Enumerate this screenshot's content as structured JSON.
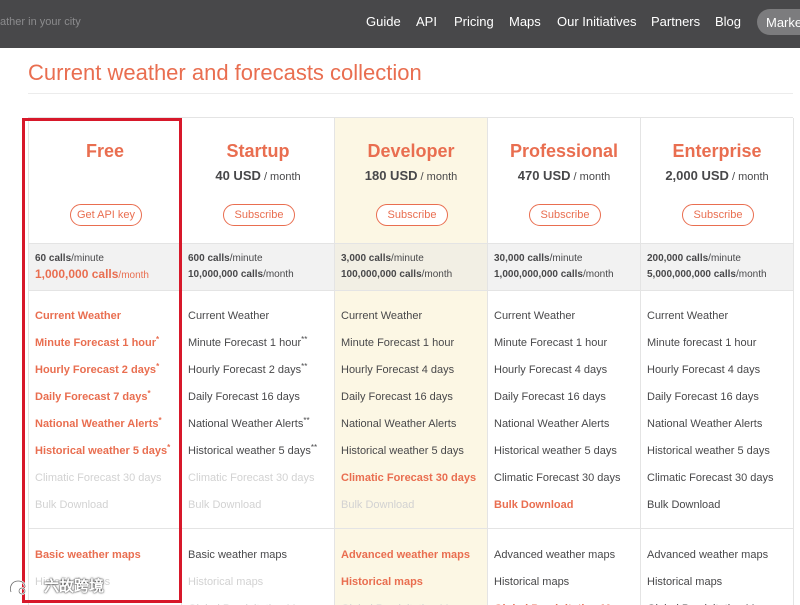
{
  "nav": {
    "search_placeholder": "ather in your city",
    "links": [
      "Guide",
      "API",
      "Pricing",
      "Maps",
      "Our Initiatives",
      "Partners",
      "Blog"
    ],
    "marketplace_label": "Marke"
  },
  "page_title": "Current weather and forecasts collection",
  "plans": [
    {
      "name": "Free",
      "price": "",
      "per": "",
      "button": "Get API key",
      "calls_minute": "60 calls",
      "calls_minute_unit": "/minute",
      "calls_month": "1,000,000 calls",
      "calls_month_unit": "/month",
      "features": [
        {
          "text": "Current Weather",
          "mark": "",
          "style": "orange"
        },
        {
          "text": "Minute Forecast 1 hour",
          "mark": "*",
          "style": "orange"
        },
        {
          "text": "Hourly Forecast 2 days",
          "mark": "*",
          "style": "orange"
        },
        {
          "text": "Daily Forecast 7 days",
          "mark": "*",
          "style": "orange"
        },
        {
          "text": "National Weather Alerts",
          "mark": "*",
          "style": "orange"
        },
        {
          "text": "Historical weather 5 days",
          "mark": "*",
          "style": "orange"
        },
        {
          "text": "Climatic Forecast 30 days",
          "mark": "",
          "style": "disabled"
        },
        {
          "text": "Bulk Download",
          "mark": "",
          "style": "disabled"
        }
      ],
      "maps": [
        {
          "text": "Basic weather maps",
          "style": "orange"
        },
        {
          "text": "Historical maps",
          "style": "disabled"
        }
      ]
    },
    {
      "name": "Startup",
      "price": "40 USD",
      "per": " / month",
      "button": "Subscribe",
      "calls_minute": "600 calls",
      "calls_minute_unit": "/minute",
      "calls_month": "10,000,000 calls",
      "calls_month_unit": "/month",
      "features": [
        {
          "text": "Current Weather",
          "mark": "",
          "style": "normal"
        },
        {
          "text": "Minute Forecast 1 hour",
          "mark": "**",
          "style": "normal"
        },
        {
          "text": "Hourly Forecast 2 days",
          "mark": "**",
          "style": "normal"
        },
        {
          "text": "Daily Forecast 16 days",
          "mark": "",
          "style": "normal"
        },
        {
          "text": "National Weather Alerts",
          "mark": "**",
          "style": "normal"
        },
        {
          "text": "Historical weather 5 days",
          "mark": "**",
          "style": "normal"
        },
        {
          "text": "Climatic Forecast 30 days",
          "mark": "",
          "style": "disabled"
        },
        {
          "text": "Bulk Download",
          "mark": "",
          "style": "disabled"
        }
      ],
      "maps": [
        {
          "text": "Basic weather maps",
          "style": "normal"
        },
        {
          "text": "Historical maps",
          "style": "disabled"
        },
        {
          "text": "Global Precipitation Map",
          "style": "disabled"
        }
      ]
    },
    {
      "name": "Developer",
      "price": "180 USD",
      "per": " / month",
      "button": "Subscribe",
      "calls_minute": "3,000 calls",
      "calls_minute_unit": "/minute",
      "calls_month": "100,000,000 calls",
      "calls_month_unit": "/month",
      "features": [
        {
          "text": "Current Weather",
          "mark": "",
          "style": "normal"
        },
        {
          "text": "Minute Forecast 1 hour",
          "mark": "",
          "style": "normal"
        },
        {
          "text": "Hourly Forecast 4 days",
          "mark": "",
          "style": "normal"
        },
        {
          "text": "Daily Forecast 16 days",
          "mark": "",
          "style": "normal"
        },
        {
          "text": "National Weather Alerts",
          "mark": "",
          "style": "normal"
        },
        {
          "text": "Historical weather 5 days",
          "mark": "",
          "style": "normal"
        },
        {
          "text": "Climatic Forecast 30 days",
          "mark": "",
          "style": "orange"
        },
        {
          "text": "Bulk Download",
          "mark": "",
          "style": "disabled"
        }
      ],
      "maps": [
        {
          "text": "Advanced weather maps",
          "style": "orange"
        },
        {
          "text": "Historical maps",
          "style": "orange"
        },
        {
          "text": "Global Precipitation Map",
          "style": "disabled"
        }
      ]
    },
    {
      "name": "Professional",
      "price": "470 USD",
      "per": " / month",
      "button": "Subscribe",
      "calls_minute": "30,000 calls",
      "calls_minute_unit": "/minute",
      "calls_month": "1,000,000,000 calls",
      "calls_month_unit": "/month",
      "features": [
        {
          "text": "Current Weather",
          "mark": "",
          "style": "normal"
        },
        {
          "text": "Minute Forecast 1 hour",
          "mark": "",
          "style": "normal"
        },
        {
          "text": "Hourly Forecast 4 days",
          "mark": "",
          "style": "normal"
        },
        {
          "text": "Daily Forecast 16 days",
          "mark": "",
          "style": "normal"
        },
        {
          "text": "National Weather Alerts",
          "mark": "",
          "style": "normal"
        },
        {
          "text": "Historical weather 5 days",
          "mark": "",
          "style": "normal"
        },
        {
          "text": "Climatic Forecast 30 days",
          "mark": "",
          "style": "normal"
        },
        {
          "text": "Bulk Download",
          "mark": "",
          "style": "orange"
        }
      ],
      "maps": [
        {
          "text": "Advanced weather maps",
          "style": "normal"
        },
        {
          "text": "Historical maps",
          "style": "normal"
        },
        {
          "text": "Global Precipitation Map",
          "style": "orange"
        }
      ]
    },
    {
      "name": "Enterprise",
      "price": "2,000 USD",
      "per": " / month",
      "button": "Subscribe",
      "calls_minute": "200,000 calls",
      "calls_minute_unit": "/minute",
      "calls_month": "5,000,000,000 calls",
      "calls_month_unit": "/month",
      "features": [
        {
          "text": "Current Weather",
          "mark": "",
          "style": "normal"
        },
        {
          "text": "Minute forecast 1 hour",
          "mark": "",
          "style": "normal"
        },
        {
          "text": "Hourly Forecast 4 days",
          "mark": "",
          "style": "normal"
        },
        {
          "text": "Daily Forecast 16 days",
          "mark": "",
          "style": "normal"
        },
        {
          "text": "National Weather Alerts",
          "mark": "",
          "style": "normal"
        },
        {
          "text": "Historical weather 5 days",
          "mark": "",
          "style": "normal"
        },
        {
          "text": "Climatic Forecast 30 days",
          "mark": "",
          "style": "normal"
        },
        {
          "text": "Bulk Download",
          "mark": "",
          "style": "normal"
        }
      ],
      "maps": [
        {
          "text": "Advanced weather maps",
          "style": "normal"
        },
        {
          "text": "Historical maps",
          "style": "normal"
        },
        {
          "text": "Global Precipitation Map",
          "style": "normal"
        }
      ]
    }
  ],
  "watermark": {
    "text": "六故跨境"
  },
  "colors": {
    "accent": "#e96e50",
    "nav_bg": "#48484a",
    "highlight_bg": "#fcf7e4",
    "selection": "#d7182a"
  }
}
